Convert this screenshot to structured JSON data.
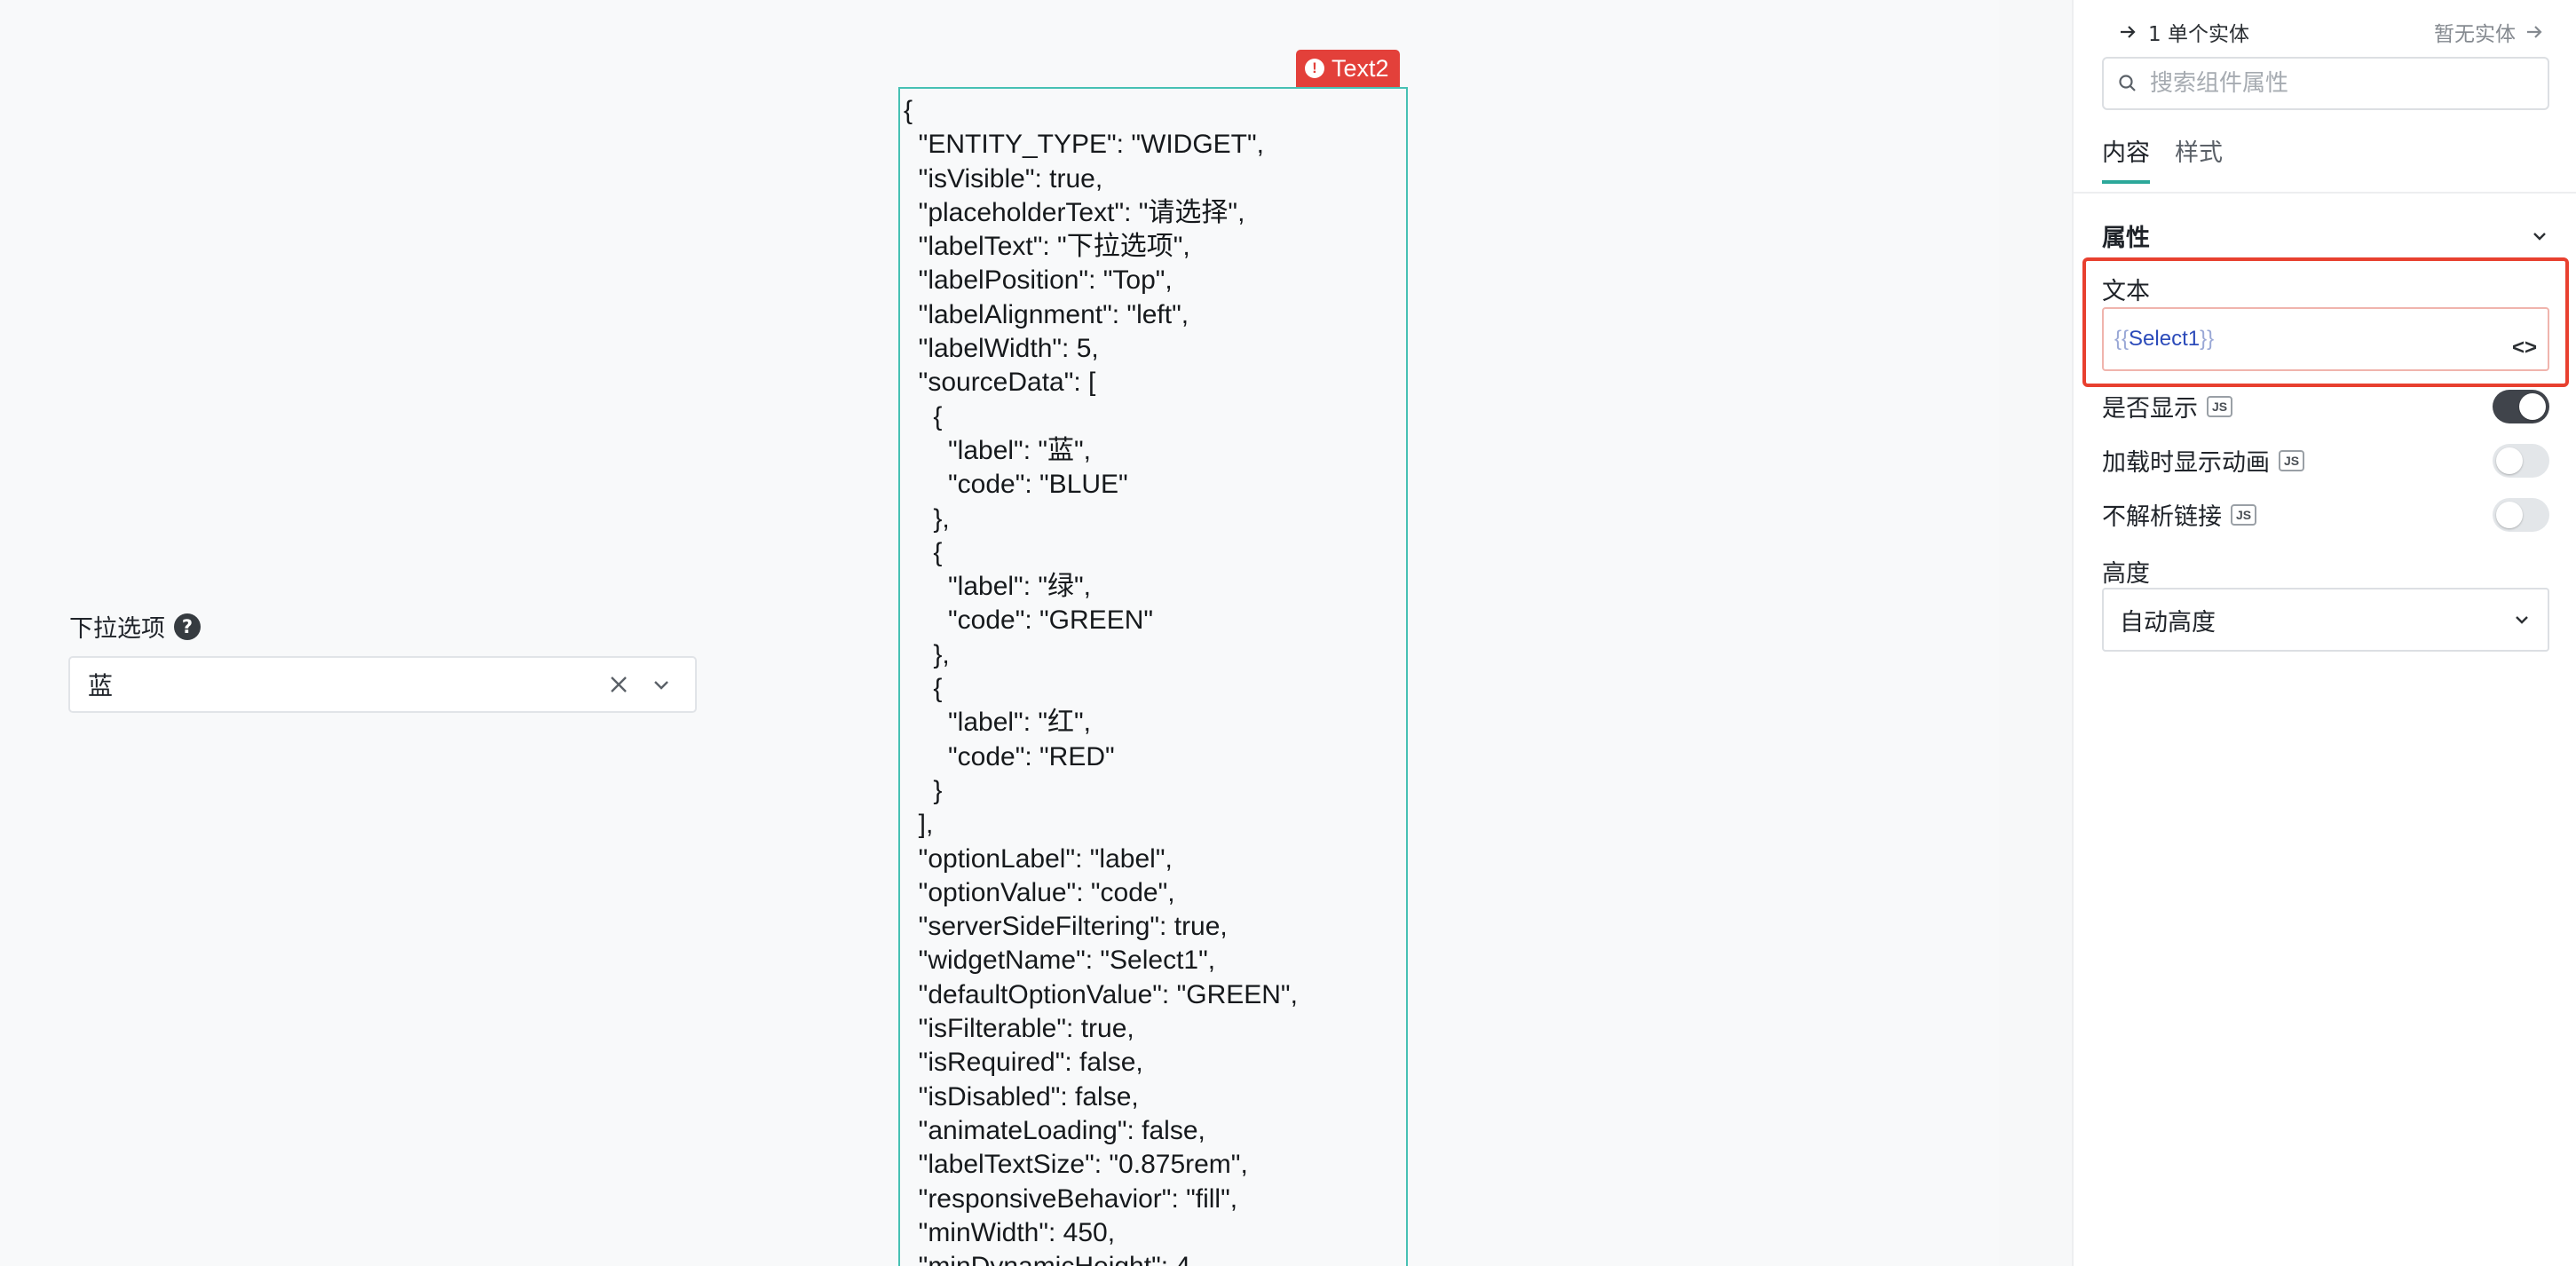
{
  "canvas": {
    "select_widget": {
      "label": "下拉选项",
      "help_icon": "question-circle-icon",
      "value": "蓝",
      "clear_icon": "close-icon",
      "dropdown_icon": "chevron-down-icon"
    },
    "text_widget": {
      "name_tag": "Text2",
      "tag_icon": "error-icon",
      "content": "{\n  \"ENTITY_TYPE\": \"WIDGET\",\n  \"isVisible\": true,\n  \"placeholderText\": \"请选择\",\n  \"labelText\": \"下拉选项\",\n  \"labelPosition\": \"Top\",\n  \"labelAlignment\": \"left\",\n  \"labelWidth\": 5,\n  \"sourceData\": [\n    {\n      \"label\": \"蓝\",\n      \"code\": \"BLUE\"\n    },\n    {\n      \"label\": \"绿\",\n      \"code\": \"GREEN\"\n    },\n    {\n      \"label\": \"红\",\n      \"code\": \"RED\"\n    }\n  ],\n  \"optionLabel\": \"label\",\n  \"optionValue\": \"code\",\n  \"serverSideFiltering\": true,\n  \"widgetName\": \"Select1\",\n  \"defaultOptionValue\": \"GREEN\",\n  \"isFilterable\": true,\n  \"isRequired\": false,\n  \"isDisabled\": false,\n  \"animateLoading\": false,\n  \"labelTextSize\": \"0.875rem\",\n  \"responsiveBehavior\": \"fill\",\n  \"minWidth\": 450,\n  \"minDynamicHeight\": 4,"
    }
  },
  "panel": {
    "entity_prev": "1 单个实体",
    "entity_next": "暂无实体",
    "search_placeholder": "搜索组件属性",
    "tabs": [
      {
        "label": "内容",
        "active": true
      },
      {
        "label": "样式",
        "active": false
      }
    ],
    "section_title": "属性",
    "text_property": {
      "label": "文本",
      "open_brace": "{{",
      "binding": "Select1",
      "close_brace": "}}"
    },
    "toggles": [
      {
        "label": "是否显示",
        "badge": "JS",
        "on": true
      },
      {
        "label": "加载时显示动画",
        "badge": "JS",
        "on": false
      },
      {
        "label": "不解析链接",
        "badge": "JS",
        "on": false
      }
    ],
    "height": {
      "label": "高度",
      "value": "自动高度"
    },
    "colors": {
      "accent": "#2ca89a",
      "highlight": "#e8402f",
      "error_tag": "#e3403a"
    }
  }
}
